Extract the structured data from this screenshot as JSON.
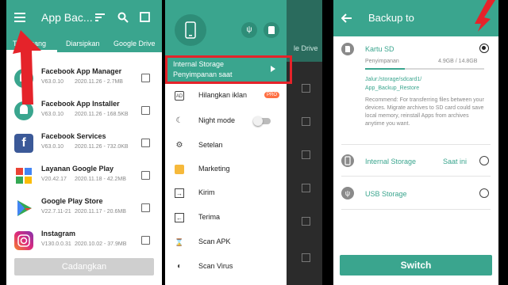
{
  "panel1": {
    "title": "App Bac...",
    "tabs": [
      "Terpasang",
      "Diarsipkan",
      "Google Drive"
    ],
    "apps": [
      {
        "name": "Facebook App Manager",
        "version": "V63.0.10",
        "meta": "2020.11.26 - 2.7MB",
        "icon_color": "#3aa58e"
      },
      {
        "name": "Facebook App Installer",
        "version": "V63.0.10",
        "meta": "2020.11.26 - 168.5KB",
        "icon_color": "#3aa58e"
      },
      {
        "name": "Facebook Services",
        "version": "V63.0.10",
        "meta": "2020.11.26 - 732.0KB",
        "icon_color": "#3b5998"
      },
      {
        "name": "Layanan Google Play",
        "version": "V20.42.17",
        "meta": "2020.11.18 - 42.2MB",
        "icon_color": "#34a853"
      },
      {
        "name": "Google Play Store",
        "version": "V22.7.11-21",
        "meta": "2020.11.17 - 20.6MB",
        "icon_color": "#4285f4"
      },
      {
        "name": "Instagram",
        "version": "V130.0.0.31",
        "meta": "2020.10.02 - 37.9MB",
        "icon_color": "#c13584"
      }
    ],
    "backup_button": "Cadangkan"
  },
  "panel2": {
    "storage_title": "Internal Storage",
    "storage_subtitle": "Penyimpanan saat",
    "menu": [
      {
        "label": "Hilangkan iklan",
        "icon": "ads-icon",
        "badge": "PRO"
      },
      {
        "label": "Night mode",
        "icon": "moon-icon"
      },
      {
        "label": "Setelan",
        "icon": "gear-icon"
      },
      {
        "label": "Marketing",
        "icon": "marketing-icon"
      },
      {
        "label": "Kirim",
        "icon": "send-icon"
      },
      {
        "label": "Terima",
        "icon": "receive-icon"
      },
      {
        "label": "Scan APK",
        "icon": "scan-apk-icon"
      },
      {
        "label": "Scan Virus",
        "icon": "scan-virus-icon"
      }
    ],
    "bg_tab": "le Drive"
  },
  "panel3": {
    "title": "Backup to",
    "sd": {
      "label": "Kartu SD",
      "storage_label": "Penyimpanan",
      "storage_value": "4.9GB / 14.8GB",
      "used_fraction": 0.33,
      "path_line1": "Jalur:/storage/sdcard1/",
      "path_line2": "App_Backup_Restore",
      "note": "Recommend: For transferring files between your devices. Migrate archives to SD card could save local memory, reinstall Apps from archives anytime you want."
    },
    "internal": {
      "label": "Internal Storage",
      "status": "Saat ini"
    },
    "usb": {
      "label": "USB Storage"
    },
    "switch_button": "Switch"
  },
  "colors": {
    "accent": "#3aa58e",
    "highlight": "#e5232a",
    "pro_badge": "#ff7043"
  }
}
